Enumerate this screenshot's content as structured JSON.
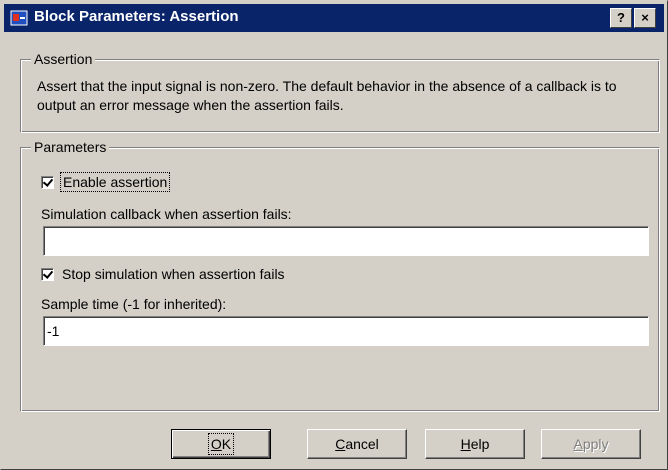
{
  "window": {
    "title": "Block Parameters: Assertion",
    "help_button": "?",
    "close_button": "×"
  },
  "assertion_group": {
    "legend": "Assertion",
    "description": "Assert that the input signal is non-zero.  The default behavior in the absence of a callback is to output an error message when the assertion fails."
  },
  "parameters_group": {
    "legend": "Parameters",
    "enable_assertion": {
      "label": "Enable assertion",
      "checked": true
    },
    "callback": {
      "label": "Simulation callback when assertion fails:",
      "value": ""
    },
    "stop_simulation": {
      "label": "Stop simulation when assertion fails",
      "checked": true
    },
    "sample_time": {
      "label": "Sample time (-1 for inherited):",
      "value": "-1"
    }
  },
  "buttons": {
    "ok": {
      "u": "O",
      "rest": "K"
    },
    "cancel": {
      "u": "C",
      "rest": "ancel"
    },
    "help": {
      "u": "H",
      "rest": "elp"
    },
    "apply": {
      "u": "A",
      "rest": "pply",
      "enabled": false
    }
  },
  "colors": {
    "title_bar": "#0a246a",
    "face": "#d4d0c8"
  },
  "icons": [
    "simulink-block-icon",
    "help-icon",
    "close-icon",
    "checkmark-icon"
  ]
}
